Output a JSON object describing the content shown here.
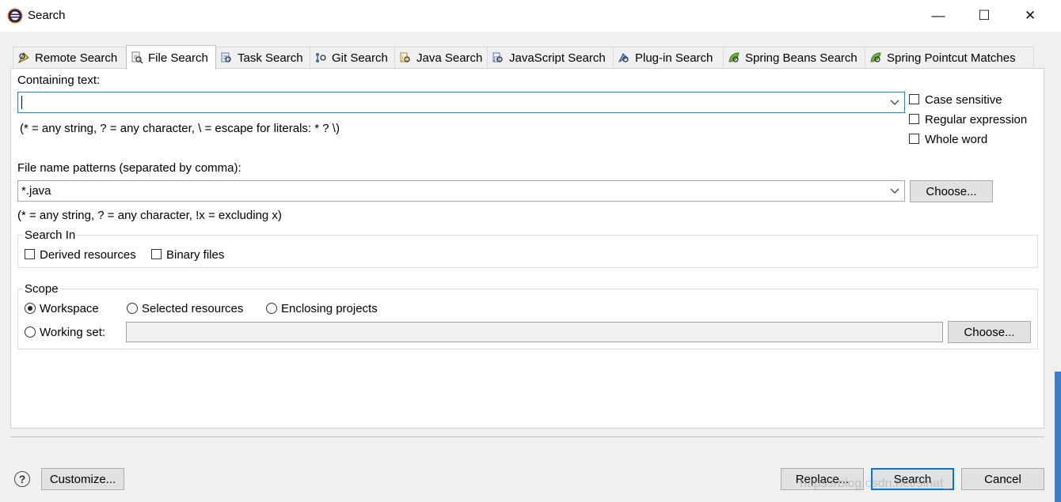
{
  "window": {
    "title": "Search",
    "controls": {
      "minimize": "—",
      "maximize": "☐",
      "close": "✕"
    }
  },
  "tabs": [
    {
      "label": "Remote Search",
      "icon": "remote-search-icon"
    },
    {
      "label": "File Search",
      "icon": "file-search-icon",
      "active": true
    },
    {
      "label": "Task Search",
      "icon": "task-search-icon"
    },
    {
      "label": "Git Search",
      "icon": "git-search-icon"
    },
    {
      "label": "Java Search",
      "icon": "java-search-icon"
    },
    {
      "label": "JavaScript Search",
      "icon": "javascript-search-icon"
    },
    {
      "label": "Plug-in Search",
      "icon": "plugin-search-icon"
    },
    {
      "label": "Spring Beans Search",
      "icon": "spring-beans-search-icon"
    },
    {
      "label": "Spring Pointcut Matches",
      "icon": "spring-pointcut-icon"
    }
  ],
  "containing": {
    "label": "Containing text:",
    "value": "",
    "hint": "(* = any string, ? = any character, \\ = escape for literals: * ? \\)"
  },
  "options": {
    "case_sensitive": "Case sensitive",
    "regular_expression": "Regular expression",
    "whole_word": "Whole word"
  },
  "file_patterns": {
    "label": "File name patterns (separated by comma):",
    "value": "*.java",
    "choose": "Choose...",
    "hint": "(* = any string, ? = any character, !x = excluding x)"
  },
  "search_in": {
    "title": "Search In",
    "derived": "Derived resources",
    "binary": "Binary files"
  },
  "scope": {
    "title": "Scope",
    "workspace": "Workspace",
    "selected": "Selected resources",
    "enclosing": "Enclosing projects",
    "working_set": "Working set:",
    "choose": "Choose...",
    "selected_option": "Workspace"
  },
  "footer": {
    "help": "?",
    "customize": "Customize...",
    "replace": "Replace...",
    "search": "Search",
    "cancel": "Cancel"
  },
  "watermark": "https://blog.csdn.net/sinat_"
}
